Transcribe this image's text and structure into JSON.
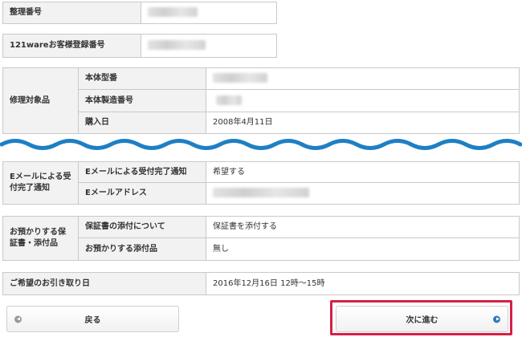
{
  "row_seiri": {
    "label": "整理番号"
  },
  "row_customer_reg": {
    "label": "121wareお客様登録番号"
  },
  "repair_target": {
    "label": "修理対象品",
    "rows": [
      {
        "label": "本体型番"
      },
      {
        "label": "本体製造番号"
      },
      {
        "label": "購入日",
        "value": "2008年4月11日"
      }
    ]
  },
  "email_notice": {
    "label": "Eメールによる受付完了通知",
    "rows": [
      {
        "label": "Eメールによる受付完了通知",
        "value": "希望する"
      },
      {
        "label": "Eメールアドレス"
      }
    ]
  },
  "deposits": {
    "label": "お預かりする保証書・添付品",
    "rows": [
      {
        "label": "保証書の添付について",
        "value": "保証書を添付する"
      },
      {
        "label": "お預かりする添付品",
        "value": "無し"
      }
    ]
  },
  "pickup": {
    "label": "ご希望のお引き取り日",
    "value": "2016年12月16日 12時～15時"
  },
  "buttons": {
    "back": "戻る",
    "next": "次に進む"
  },
  "colors": {
    "wave": "#1e7fc4",
    "highlight": "#d61f47",
    "next_icon": "#2f7cc0"
  }
}
